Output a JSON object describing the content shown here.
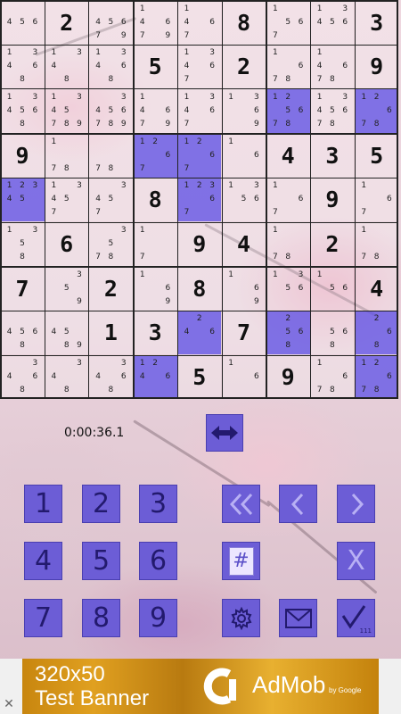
{
  "colors": {
    "highlight": "#685ae6",
    "button_fill": "#6c5dd6",
    "button_border": "#4a3fb0",
    "icon_dark": "#231a6e",
    "grid_line": "#222222"
  },
  "grid": {
    "cells": [
      [
        {
          "c": "456"
        },
        {
          "v": "2"
        },
        {
          "c": "45679"
        },
        {
          "v": "1"
        },
        {
          "c": "14679"
        },
        {
          "c": "1467"
        },
        {
          "v": "8"
        },
        {
          "c": "1567"
        },
        {
          "c": "13456"
        },
        {
          "v": "3"
        }
      ],
      []
    ],
    "rows": [
      [
        {
          "c": "456"
        },
        {
          "v": "2"
        },
        {
          "c": "45679"
        },
        {
          "c": "14679"
        },
        {
          "c": "1467"
        },
        {
          "v": "8"
        },
        {
          "c": "1567"
        },
        {
          "c": "13456"
        },
        {
          "v": "3"
        }
      ],
      [
        {
          "c": "13468"
        },
        {
          "c": "1348"
        },
        {
          "c": "13468"
        },
        {
          "v": "5"
        },
        {
          "c": "13467"
        },
        {
          "v": "2"
        },
        {
          "c": "1678"
        },
        {
          "c": "14678"
        },
        {
          "v": "9"
        }
      ],
      [
        {
          "c": "134568"
        },
        {
          "c": "1345789"
        },
        {
          "c": "3456789"
        },
        {
          "c": "14679"
        },
        {
          "c": "13467"
        },
        {
          "c": "1369"
        },
        {
          "c": "125678",
          "h": true
        },
        {
          "c": "1345678"
        },
        {
          "c": "12678",
          "h": true
        }
      ],
      [
        {
          "v": "9"
        },
        {
          "c": "178"
        },
        {
          "c": "78"
        },
        {
          "c": "1267",
          "h": true
        },
        {
          "c": "1267",
          "h": true
        },
        {
          "c": "16"
        },
        {
          "v": "4"
        },
        {
          "v": "3"
        },
        {
          "v": "5"
        }
      ],
      [
        {
          "c": "12345",
          "h": true
        },
        {
          "c": "13457"
        },
        {
          "c": "3457"
        },
        {
          "v": "8"
        },
        {
          "c": "12367",
          "h": true
        },
        {
          "c": "1356"
        },
        {
          "c": "167"
        },
        {
          "v": "9"
        },
        {
          "c": "167"
        }
      ],
      [
        {
          "c": "1358"
        },
        {
          "v": "6"
        },
        {
          "c": "3578"
        },
        {
          "c": "17"
        },
        {
          "v": "9"
        },
        {
          "v": "4"
        },
        {
          "c": "178"
        },
        {
          "v": "2"
        },
        {
          "c": "178"
        }
      ],
      [
        {
          "v": "7"
        },
        {
          "c": "359"
        },
        {
          "v": "2"
        },
        {
          "c": "169"
        },
        {
          "v": "8"
        },
        {
          "c": "169"
        },
        {
          "c": "1356"
        },
        {
          "c": "156"
        },
        {
          "v": "4"
        }
      ],
      [
        {
          "c": "4568"
        },
        {
          "c": "4589"
        },
        {
          "v": "1"
        },
        {
          "v": "3"
        },
        {
          "c": "246",
          "h": true
        },
        {
          "v": "7"
        },
        {
          "c": "2568",
          "h": true
        },
        {
          "c": "568"
        },
        {
          "c": "268",
          "h": true
        }
      ],
      [
        {
          "c": "3468"
        },
        {
          "c": "348"
        },
        {
          "c": "3468"
        },
        {
          "c": "1246",
          "h": true
        },
        {
          "v": "5"
        },
        {
          "c": "16"
        },
        {
          "v": "9"
        },
        {
          "c": "1678"
        },
        {
          "c": "12678",
          "h": true
        }
      ]
    ]
  },
  "timer": "0:00:36.1",
  "controls": {
    "numbers": [
      "1",
      "2",
      "3",
      "4",
      "5",
      "6",
      "7",
      "8",
      "9"
    ],
    "hash_label": "#",
    "clear_label": "X",
    "check_sub": "111"
  },
  "ad": {
    "line1": "320x50",
    "line2": "Test Banner",
    "brand": "AdMob",
    "by": "by Google",
    "close": "✕"
  }
}
